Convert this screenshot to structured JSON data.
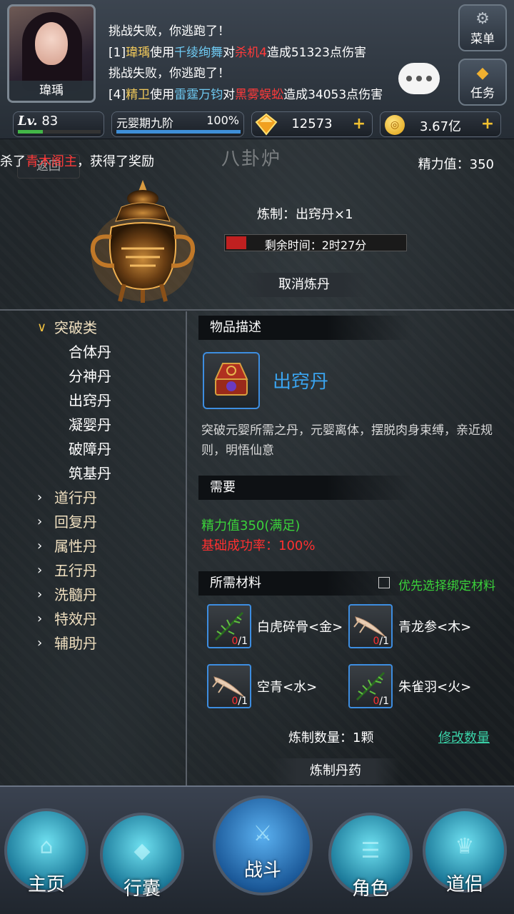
{
  "player": {
    "name": "瑋瑀",
    "level": "83",
    "level_progress": 0.3,
    "stage": "元婴期九阶",
    "stage_pct": "100%",
    "stage_progress": 1.0
  },
  "currency": {
    "gems": "12573",
    "gold": "3.67亿"
  },
  "buttons": {
    "menu": "菜单",
    "quest": "任务",
    "back": "返回",
    "cancel": "取消炼丹",
    "craft": "炼制丹药",
    "modify_qty": "修改数量"
  },
  "chat_log": [
    {
      "parts": [
        {
          "t": "挑战失败，你逃跑了！",
          "c": "w"
        }
      ]
    },
    {
      "parts": [
        {
          "t": "[1]",
          "c": "w"
        },
        {
          "t": "瑋瑀",
          "c": "y"
        },
        {
          "t": "使用",
          "c": "w"
        },
        {
          "t": "千绫绚舞",
          "c": "c"
        },
        {
          "t": "对",
          "c": "w"
        },
        {
          "t": "杀机4",
          "c": "r"
        },
        {
          "t": "造成51323点伤害",
          "c": "w"
        }
      ]
    },
    {
      "parts": [
        {
          "t": "挑战失败，你逃跑了！",
          "c": "w"
        }
      ]
    },
    {
      "parts": [
        {
          "t": "[4]",
          "c": "w"
        },
        {
          "t": "精卫",
          "c": "y"
        },
        {
          "t": "使用",
          "c": "w"
        },
        {
          "t": "雷霆万钧",
          "c": "c"
        },
        {
          "t": "对",
          "c": "w"
        },
        {
          "t": "黑雾蜈蚣",
          "c": "r"
        },
        {
          "t": "造成34053点伤害",
          "c": "w"
        }
      ]
    }
  ],
  "ticker": {
    "pre": "杀了",
    "name": "青木阁主",
    "post": "，获得了奖励"
  },
  "page_title": "八卦炉",
  "energy": "精力值：350",
  "crafting": {
    "label": "炼制：出窍丹×1",
    "remaining": "剩余时间：2时27分",
    "progress": 0.1
  },
  "categories": [
    {
      "label": "突破类",
      "open": true,
      "items": [
        "合体丹",
        "分神丹",
        "出窍丹",
        "凝婴丹",
        "破障丹",
        "筑基丹"
      ]
    },
    {
      "label": "道行丹",
      "open": false,
      "items": []
    },
    {
      "label": "回复丹",
      "open": false,
      "items": []
    },
    {
      "label": "属性丹",
      "open": false,
      "items": []
    },
    {
      "label": "五行丹",
      "open": false,
      "items": []
    },
    {
      "label": "洗髓丹",
      "open": false,
      "items": []
    },
    {
      "label": "特效丹",
      "open": false,
      "items": []
    },
    {
      "label": "辅助丹",
      "open": false,
      "items": []
    }
  ],
  "detail": {
    "sec_desc": "物品描述",
    "item_name": "出窍丹",
    "desc": "突破元婴所需之丹，元婴离体，摆脱肉身束缚，亲近规则，明悟仙意",
    "sec_need": "需要",
    "need_energy": "精力值350(满足)",
    "need_rate": "基础成功率：100%",
    "sec_mat": "所需材料",
    "bind_pref": "优先选择绑定材料",
    "materials": [
      {
        "name": "白虎碎骨<金>",
        "have": "0",
        "need": "/1",
        "icon": "thorn-herb-icon"
      },
      {
        "name": "青龙参<木>",
        "have": "0",
        "need": "/1",
        "icon": "root-icon"
      },
      {
        "name": "空青<水>",
        "have": "0",
        "need": "/1",
        "icon": "root-icon"
      },
      {
        "name": "朱雀羽<火>",
        "have": "0",
        "need": "/1",
        "icon": "thorn-herb-icon"
      }
    ],
    "quantity": "炼制数量：1颗"
  },
  "nav": [
    {
      "label": "主页",
      "icon": "home-icon"
    },
    {
      "label": "行囊",
      "icon": "bag-icon"
    },
    {
      "label": "战斗",
      "icon": "battle-icon"
    },
    {
      "label": "角色",
      "icon": "character-icon"
    },
    {
      "label": "道侣",
      "icon": "companion-icon"
    }
  ]
}
